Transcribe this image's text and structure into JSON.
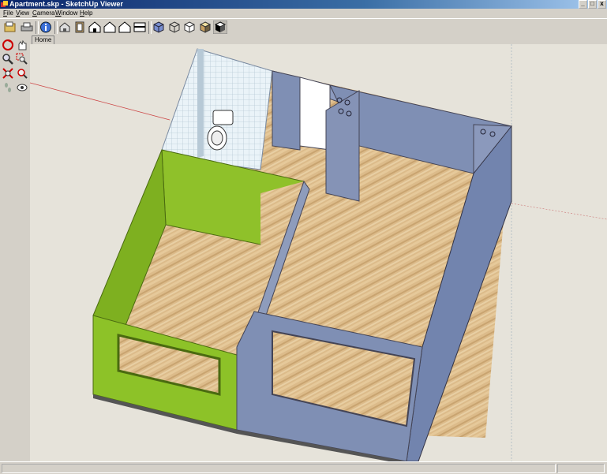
{
  "window": {
    "title": "Apartment.skp - SketchUp Viewer",
    "buttons": [
      "_",
      "□",
      "x"
    ]
  },
  "menu": [
    {
      "label": "File",
      "mnemonic": "F",
      "rest": "ile"
    },
    {
      "label": "View",
      "mnemonic": "V",
      "rest": "iew"
    },
    {
      "label": "Camera",
      "mnemonic": "C",
      "rest": "amera"
    },
    {
      "label": "Window",
      "mnemonic": "W",
      "rest": "indow"
    },
    {
      "label": "Help",
      "mnemonic": "H",
      "rest": "elp"
    }
  ],
  "toolbar": {
    "icons": [
      "open-file-icon",
      "print-icon",
      "model-info-icon",
      "iso-view-icon",
      "top-view-icon",
      "front-view-icon",
      "right-view-icon",
      "back-view-icon",
      "left-view-icon",
      "xray-icon",
      "wireframe-icon",
      "hidden-line-icon",
      "shaded-icon",
      "shaded-textures-icon"
    ]
  },
  "left_tools": [
    "orbit-icon",
    "pan-icon",
    "zoom-icon",
    "zoom-window-icon",
    "zoom-extents-icon",
    "previous-view-icon",
    "walk-icon",
    "look-around-icon"
  ],
  "tabs": [
    {
      "label": "Home"
    }
  ],
  "colors": {
    "accent_wall": "#8dc228",
    "blue_wall": "#7f8fb4",
    "wood_floor": "#d9b683",
    "tile": "#e8f1f6",
    "background": "#e6e3da"
  }
}
